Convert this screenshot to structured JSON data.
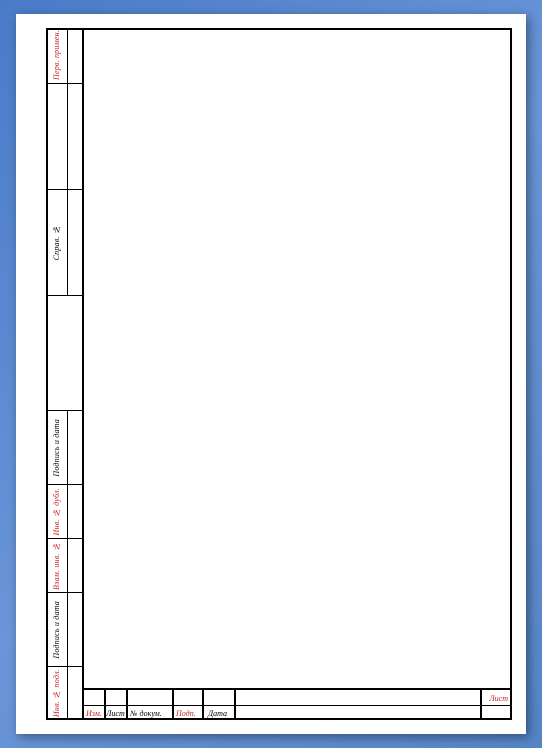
{
  "sidebar_upper": {
    "col1": {
      "c1": "Перв. примен.",
      "c2": "",
      "c3": "Справ. №"
    }
  },
  "sidebar_lower": {
    "col1": {
      "c1": "Инв. № подл.",
      "c2": "Подпись и дата",
      "c3": "Взам. инв. №",
      "c4": "Инв. № дубл.",
      "c5": "Подпись и дата"
    }
  },
  "stamp": {
    "izm": "Изм.",
    "list": "Лист",
    "ndoc": "№ докум.",
    "podp": "Подп.",
    "data": "Дата",
    "list_right": "Лист"
  }
}
